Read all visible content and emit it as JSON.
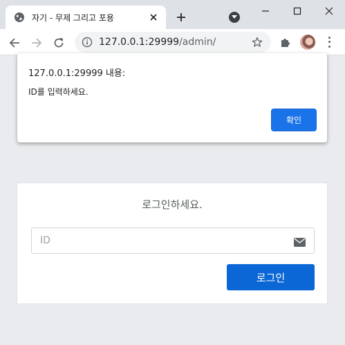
{
  "browser": {
    "tab": {
      "title": "자기 - 무제 그리고 포용"
    },
    "address": {
      "host": "127.0.0.1:29999",
      "path": "/admin/"
    }
  },
  "dialog": {
    "title": "127.0.0.1:29999 내용:",
    "message": "ID를 입력하세요.",
    "ok_label": "확인"
  },
  "login": {
    "heading": "로그인하세요.",
    "id_placeholder": "ID",
    "id_value": "",
    "submit_label": "로그인"
  },
  "colors": {
    "primary_button": "#0b66d6",
    "dialog_button": "#1a73e8",
    "page_background": "#e9ebee"
  },
  "icons": [
    "globe-icon",
    "close-icon",
    "plus-icon",
    "tab-search-icon",
    "minimize-icon",
    "maximize-icon",
    "window-close-icon",
    "back-icon",
    "forward-icon",
    "reload-icon",
    "info-icon",
    "star-icon",
    "puzzle-icon",
    "kebab-menu-icon",
    "envelope-icon"
  ]
}
